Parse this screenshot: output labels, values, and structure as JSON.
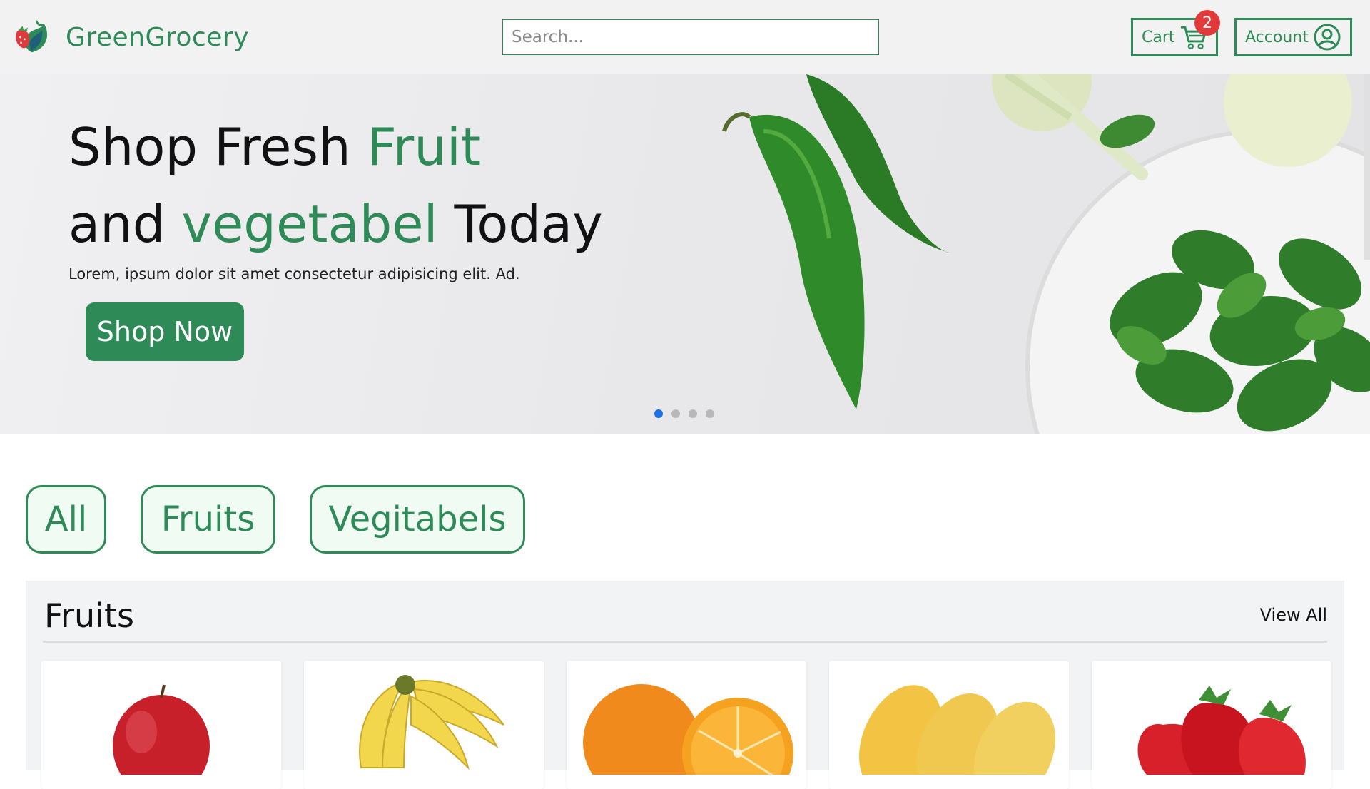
{
  "brand": {
    "name": "GreenGrocery",
    "accent": "#2e8b57"
  },
  "search": {
    "placeholder": "Search..."
  },
  "header": {
    "cart_label": "Cart",
    "cart_count": "2",
    "account_label": "Account"
  },
  "hero": {
    "line1_a": "Shop Fresh ",
    "line1_b": "Fruit",
    "line2_a": "and ",
    "line2_b": "vegetabel",
    "line2_c": " Today",
    "subtitle": "Lorem, ipsum dolor sit amet consectetur adipisicing elit. Ad.",
    "cta": "Shop Now",
    "slides": 4,
    "active_slide": 1
  },
  "filters": [
    "All",
    "Fruits",
    "Vegitabels"
  ],
  "section": {
    "title": "Fruits",
    "view_all": "View All",
    "products": [
      {
        "icon": "apple-image"
      },
      {
        "icon": "banana-image"
      },
      {
        "icon": "orange-image"
      },
      {
        "icon": "mango-image"
      },
      {
        "icon": "strawberry-image"
      }
    ]
  },
  "colors": {
    "badge": "#e23a3a",
    "dot_active": "#1a73e8",
    "dot_inactive": "#b8b8b8"
  }
}
